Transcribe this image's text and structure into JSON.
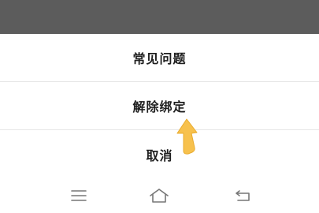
{
  "action_sheet": {
    "items": [
      {
        "label": "常见问题"
      },
      {
        "label": "解除绑定"
      }
    ],
    "cancel_label": "取消"
  },
  "annotation": {
    "arrow_color": "#f7c14d",
    "arrow_icon": "arrow-pointer-icon"
  },
  "nav_bar": {
    "icons": [
      "menu-icon",
      "home-icon",
      "back-icon"
    ],
    "icon_color": "#777777"
  },
  "colors": {
    "overlay": "#5c5c5c",
    "text": "#1f1f1f",
    "divider": "#e6e6e6"
  }
}
